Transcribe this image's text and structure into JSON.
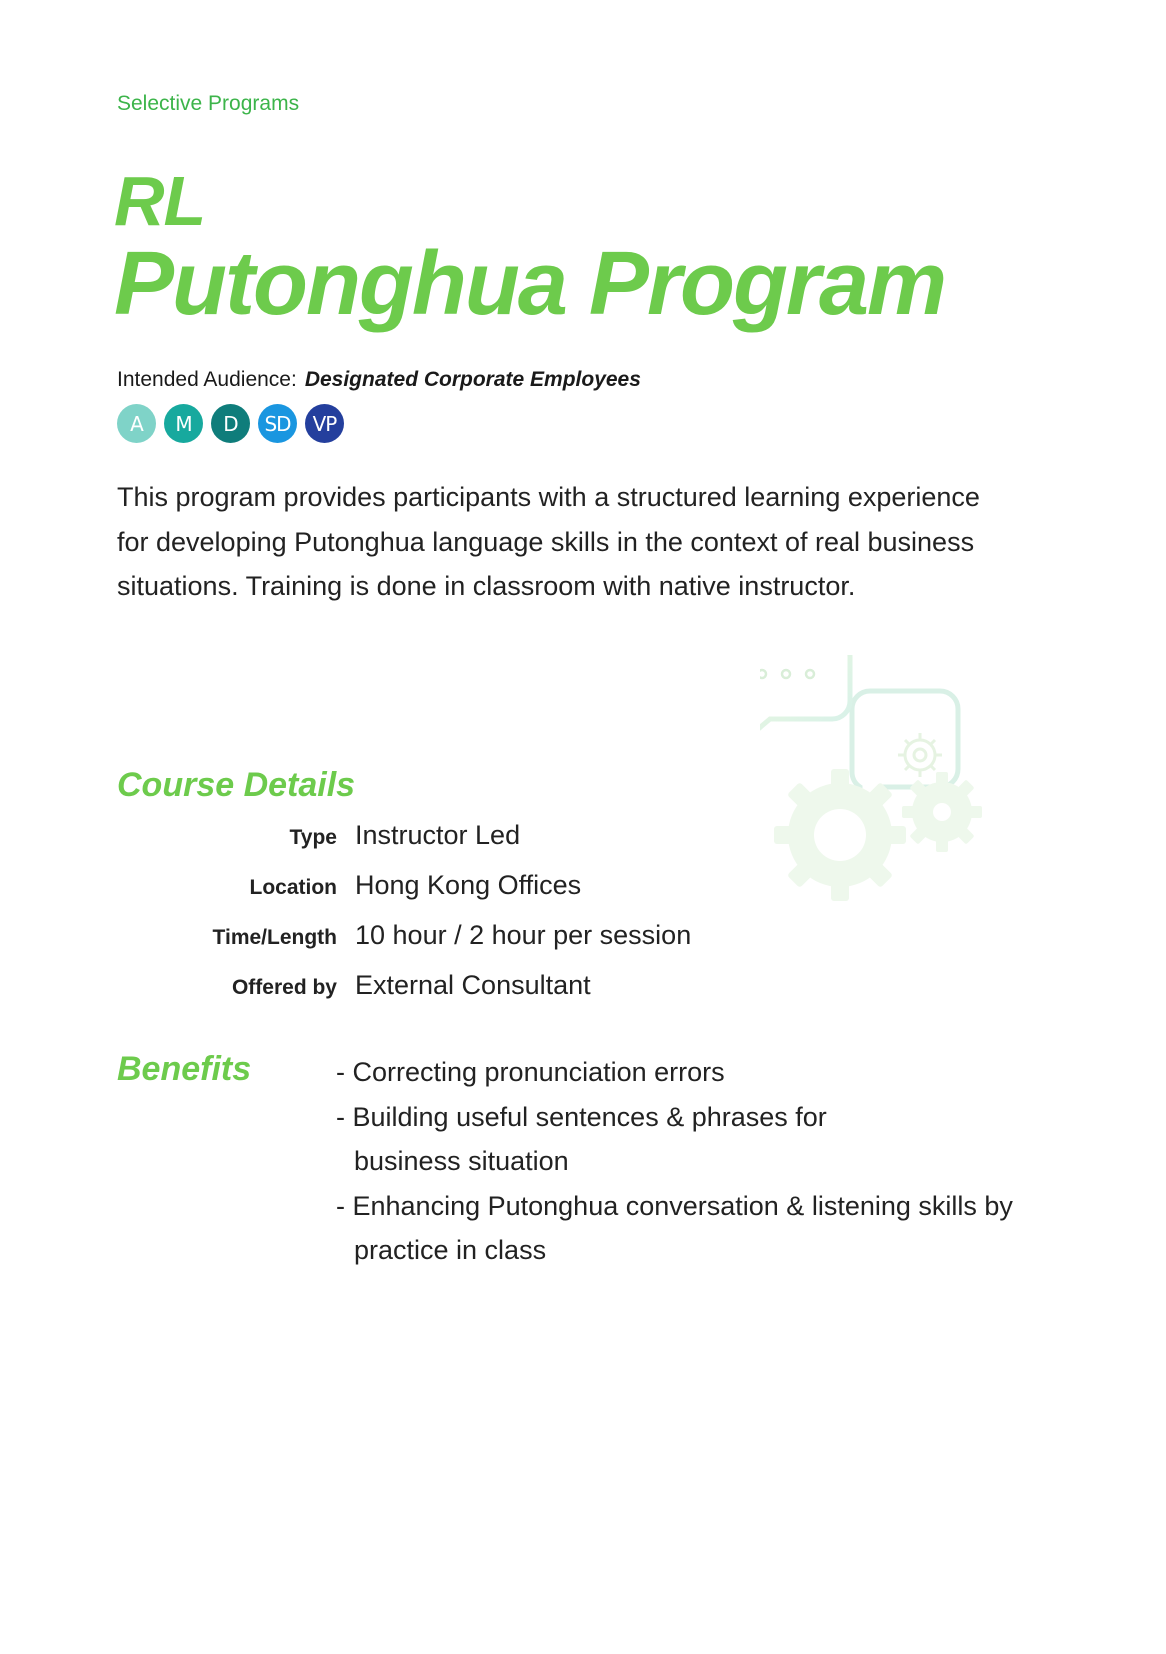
{
  "header": {
    "section": "Selective Programs"
  },
  "title": {
    "line1": "RL",
    "line2": "Putonghua Program"
  },
  "audience": {
    "label": "Intended Audience:",
    "value": "Designated Corporate Employees",
    "badges": [
      {
        "text": "A",
        "color": "#7fd3c8"
      },
      {
        "text": "M",
        "color": "#17a99e"
      },
      {
        "text": "D",
        "color": "#0f7d7b"
      },
      {
        "text": "SD",
        "color": "#1a96e0"
      },
      {
        "text": "VP",
        "color": "#243f9d"
      }
    ]
  },
  "intro": "This program provides participants with a structured learning experience for developing Putonghua language skills in the context of real business situations. Training is done in classroom with native instructor.",
  "course_details": {
    "heading": "Course Details",
    "rows": [
      {
        "key": "Type",
        "value": "Instructor Led"
      },
      {
        "key": "Location",
        "value": "Hong Kong Offices"
      },
      {
        "key": "Time/Length",
        "value": "10 hour / 2 hour per session"
      },
      {
        "key": "Offered by",
        "value": "External Consultant"
      }
    ]
  },
  "benefits": {
    "heading": "Benefits",
    "items": [
      "- Correcting pronunciation errors",
      "- Building useful sentences & phrases for business situation",
      "- Enhancing Putonghua conversation & listening skills by practice in class"
    ]
  },
  "decor": {
    "icon": "chat-gears-icon",
    "accent": "#6dcb4c"
  }
}
